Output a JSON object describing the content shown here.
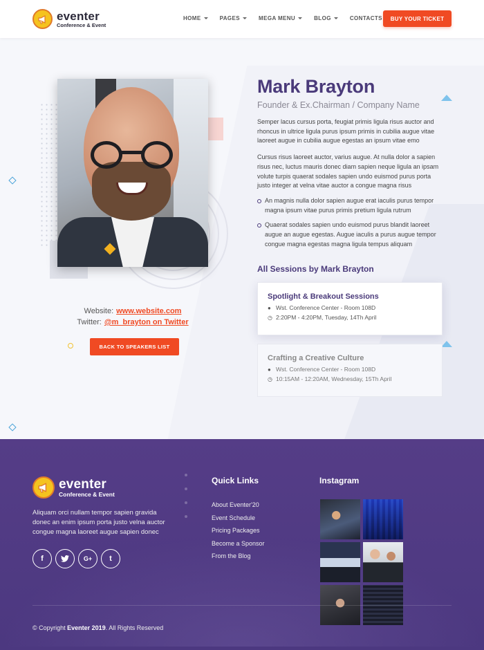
{
  "brand": {
    "name": "eventer",
    "tagline": "Conference & Event"
  },
  "nav": {
    "items": [
      {
        "label": "HOME"
      },
      {
        "label": "PAGES"
      },
      {
        "label": "MEGA MENU"
      },
      {
        "label": "BLOG"
      },
      {
        "label": "CONTACTS"
      }
    ],
    "cta": "BUY YOUR TICKET"
  },
  "speaker": {
    "name": "Mark Brayton",
    "role": "Founder & Ex.Chairman / Company Name",
    "paragraph_1": "Semper lacus cursus porta, feugiat primis ligula risus auctor and rhoncus in ultrice ligula purus ipsum primis in cubilia augue vitae laoreet augue in cubilia augue egestas an ipsum vitae emo",
    "paragraph_2": "Cursus risus laoreet auctor, varius augue. At nulla dolor a sapien risus nec, luctus mauris donec diam sapien neque ligula an ipsam volute turpis quaerat sodales sapien undo euismod purus porta justo integer at velna vitae auctor a congue magna risus",
    "bullets": [
      "An magnis nulla dolor sapien augue erat iaculis purus tempor magna ipsum vitae purus primis pretium ligula rutrum",
      "Quaerat sodales sapien undo euismod purus blandit laoreet augue an augue egestas. Augue iaculis a purus augue tempor congue magna egestas magna ligula tempus aliquam"
    ],
    "website_label": "Website:",
    "website": "www.website.com",
    "twitter_label": "Twitter:",
    "twitter": "@m_brayton on Twitter",
    "back_button": "BACK TO SPEAKERS LIST"
  },
  "sessions": {
    "title": "All Sessions by Mark Brayton",
    "items": [
      {
        "title": "Spotlight & Breakout Sessions",
        "location": "Wst. Conference Center - Room 108D",
        "time": "2:20PM - 4:20PM, Tuesday, 14Th April"
      },
      {
        "title": "Crafting a Creative Culture",
        "location": "Wst. Conference Center - Room 108D",
        "time": "10:15AM - 12:20AM, Wednesday, 15Th April"
      }
    ]
  },
  "footer": {
    "description": "Aliquam orci nullam tempor sapien gravida donec an enim ipsum porta justo velna auctor congue magna laoreet augue sapien donec",
    "socials": [
      {
        "icon": "facebook-icon",
        "glyph": "f"
      },
      {
        "icon": "twitter-icon",
        "glyph": "t"
      },
      {
        "icon": "google-plus-icon",
        "glyph": "G+"
      },
      {
        "icon": "tumblr-icon",
        "glyph": "t"
      }
    ],
    "quick_links_title": "Quick Links",
    "quick_links": [
      "About Eventer'20",
      "Event Schedule",
      "Pricing Packages",
      "Become a Sponsor",
      "From the Blog"
    ],
    "instagram_title": "Instagram",
    "copyright_prefix": "© Copyright ",
    "copyright_brand": "Eventer 2019",
    "copyright_suffix": ". All Rights Reserved"
  },
  "colors": {
    "accent": "#f04a23",
    "brand_purple": "#4a3a7a",
    "footer_bg": "#553d87",
    "logo_yellow": "#f5c31f"
  }
}
